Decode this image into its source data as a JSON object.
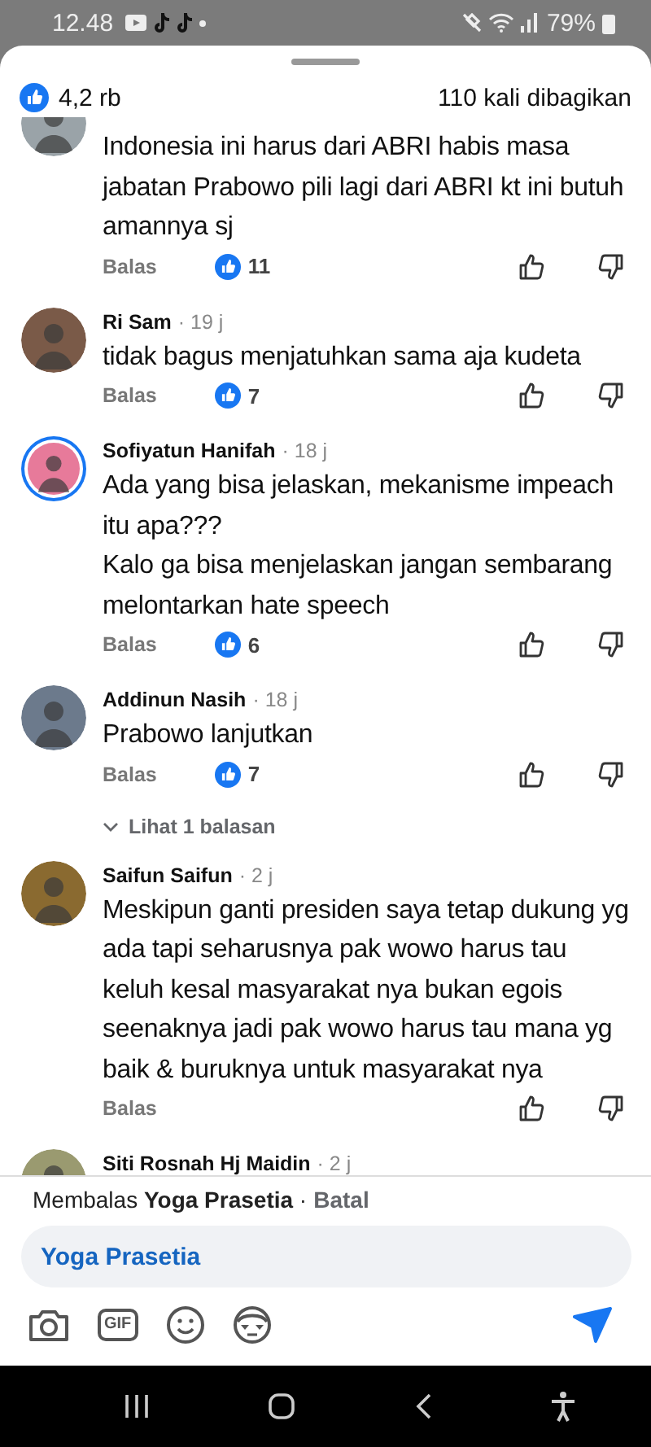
{
  "status_bar": {
    "time": "12.48",
    "battery": "79%"
  },
  "header": {
    "likes": "4,2 rb",
    "shares": "110 kali dibagikan"
  },
  "comments": [
    {
      "text": "Indonesia ini harus dari ABRI  habis masa jabatan Prabowo pili lagi dari ABRI  kt ini butuh amannya sj",
      "reply_label": "Balas",
      "likes": "11"
    },
    {
      "name": "Ri Sam",
      "time": "· 19 j",
      "text": "tidak bagus menjatuhkan sama aja kudeta",
      "reply_label": "Balas",
      "likes": "7"
    },
    {
      "name": "Sofiyatun Hanifah",
      "time": "· 18 j",
      "story_ring": true,
      "text": "Ada yang bisa jelaskan, mekanisme impeach itu apa???\nKalo ga bisa menjelaskan jangan sembarang melontarkan hate speech",
      "reply_label": "Balas",
      "likes": "6"
    },
    {
      "name": "Addinun Nasih",
      "time": "· 18 j",
      "text": "Prabowo lanjutkan",
      "reply_label": "Balas",
      "likes": "7",
      "replies_link": "Lihat 1 balasan"
    },
    {
      "name": "Saifun Saifun",
      "time": "· 2 j",
      "text": "Meskipun ganti presiden saya tetap dukung yg ada tapi seharusnya pak wowo harus tau keluh kesal masyarakat nya bukan egois seenaknya jadi pak wowo harus tau mana yg baik & buruknya untuk masyarakat nya",
      "reply_label": "Balas"
    },
    {
      "name": "Siti Rosnah Hj Maidin",
      "time": "· 2 j"
    }
  ],
  "reply_bar": {
    "prefix": "Membalas",
    "name": "Yoga Prasetia",
    "separator": "·",
    "cancel": "Batal"
  },
  "input": {
    "value": "Yoga Prasetia"
  },
  "composer": {
    "gif_label": "GIF"
  }
}
